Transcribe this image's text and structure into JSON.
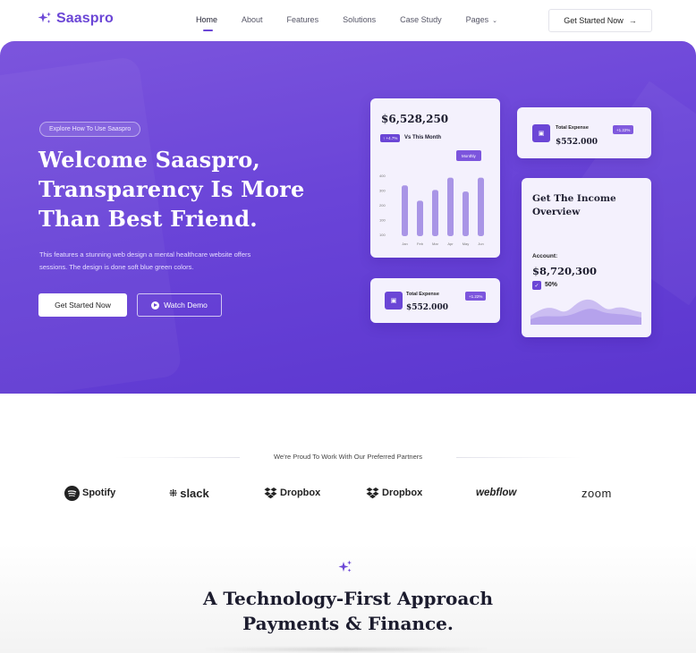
{
  "brand": {
    "name": "Saaspro",
    "accent": "#6b46d6"
  },
  "nav": {
    "links": [
      {
        "label": "Home",
        "active": true
      },
      {
        "label": "About"
      },
      {
        "label": "Features"
      },
      {
        "label": "Solutions"
      },
      {
        "label": "Case Study"
      },
      {
        "label": "Pages",
        "has_dropdown": true
      }
    ],
    "cta_label": "Get Started Now"
  },
  "hero": {
    "tag": "Explore How To Use Saaspro",
    "title_line1": "Welcome Saaspro,",
    "title_line2": "Transparency Is More",
    "title_line3": "Than Best Friend.",
    "description_line1": "This features a stunning web design a mental healthcare website offers",
    "description_line2": "sessions. The design is done soft blue green colors.",
    "primary_button": "Get Started Now",
    "secondary_button": "Watch Demo"
  },
  "revenue_card": {
    "amount": "$6,528,250",
    "badge": "↑ +4.7%",
    "vs_label": "Vs This Month",
    "period": "Monthly",
    "chart_data": {
      "type": "bar",
      "categories": [
        "Jan",
        "Feb",
        "Mar",
        "Apr",
        "May",
        "Jun"
      ],
      "values": [
        330,
        230,
        300,
        380,
        290,
        380
      ],
      "y_ticks": [
        "400",
        "300",
        "200",
        "100",
        "100"
      ],
      "ylim": [
        0,
        430
      ],
      "color": "#a995e6"
    }
  },
  "expense_top": {
    "label": "Total Expense",
    "amount": "$552.000",
    "pill": "+1.22%"
  },
  "expense_bottom": {
    "label": "Total Expense",
    "amount": "$552.000",
    "pill": "+1.22%"
  },
  "income_card": {
    "title_line1": "Get The Income",
    "title_line2": "Overview",
    "account_label": "Account:",
    "amount": "$8,720,300",
    "percent": "50%"
  },
  "partners": {
    "title": "We're Proud To Work With Our Preferred Partners",
    "logos": [
      "Spotify",
      "slack",
      "Dropbox",
      "Dropbox",
      "webflow",
      "zoom"
    ]
  },
  "section2": {
    "title_line1": "A Technology-First Approach",
    "title_line2": "Payments & Finance."
  }
}
